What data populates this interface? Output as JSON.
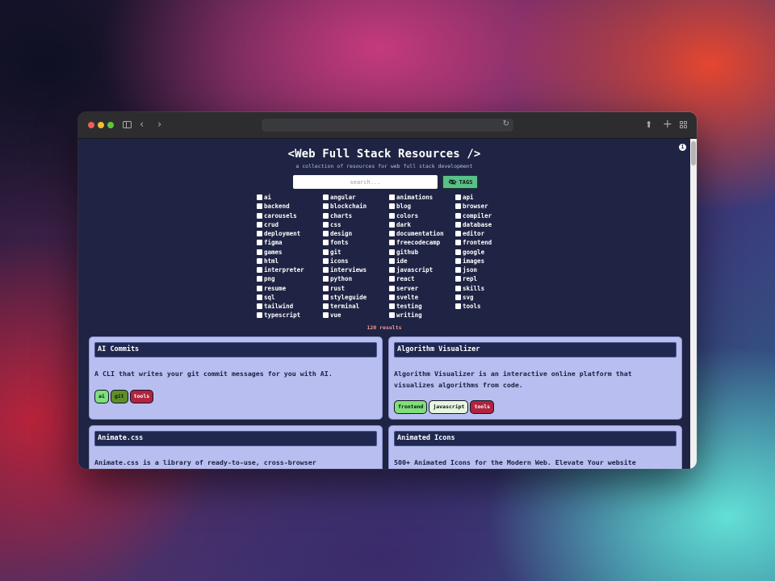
{
  "page": {
    "title": "<Web Full Stack Resources />",
    "subtitle": "a collection of resources for web full stack development",
    "search_placeholder": "search...",
    "tags_button_label": "TAGS",
    "results_count": "120 results"
  },
  "tags": [
    "ai",
    "angular",
    "animations",
    "api",
    "backend",
    "blockchain",
    "blog",
    "browser",
    "carousels",
    "charts",
    "colors",
    "compiler",
    "crud",
    "css",
    "dark",
    "database",
    "deployment",
    "design",
    "documentation",
    "editor",
    "figma",
    "fonts",
    "freecodecamp",
    "frontend",
    "games",
    "git",
    "github",
    "google",
    "html",
    "icons",
    "ide",
    "images",
    "interpreter",
    "interviews",
    "javascript",
    "json",
    "png",
    "python",
    "react",
    "repl",
    "resume",
    "rust",
    "server",
    "skills",
    "sql",
    "styleguide",
    "svelte",
    "svg",
    "tailwind",
    "terminal",
    "testing",
    "tools",
    "typescript",
    "vue",
    "writing"
  ],
  "cards": [
    {
      "title": "AI Commits",
      "description": "A CLI that writes your git commit messages for you with AI.",
      "badges": [
        "ai",
        "git",
        "tools"
      ]
    },
    {
      "title": "Algorithm Visualizer",
      "description": "Algorithm Visualizer is an interactive online platform that visualizes algorithms from code.",
      "badges": [
        "frontend",
        "javascript",
        "tools"
      ]
    },
    {
      "title": "Animate.css",
      "description": "Animate.css is a library of ready-to-use, cross-browser",
      "badges": []
    },
    {
      "title": "Animated Icons",
      "description": "500+ Animated Icons for the Modern Web. Elevate Your website",
      "badges": []
    }
  ],
  "colors": {
    "page_background": "#1f2444",
    "card_background": "#b8bff0",
    "card_header": "#202850",
    "tags_button": "#58c088",
    "results_text": "#f29a9a"
  }
}
